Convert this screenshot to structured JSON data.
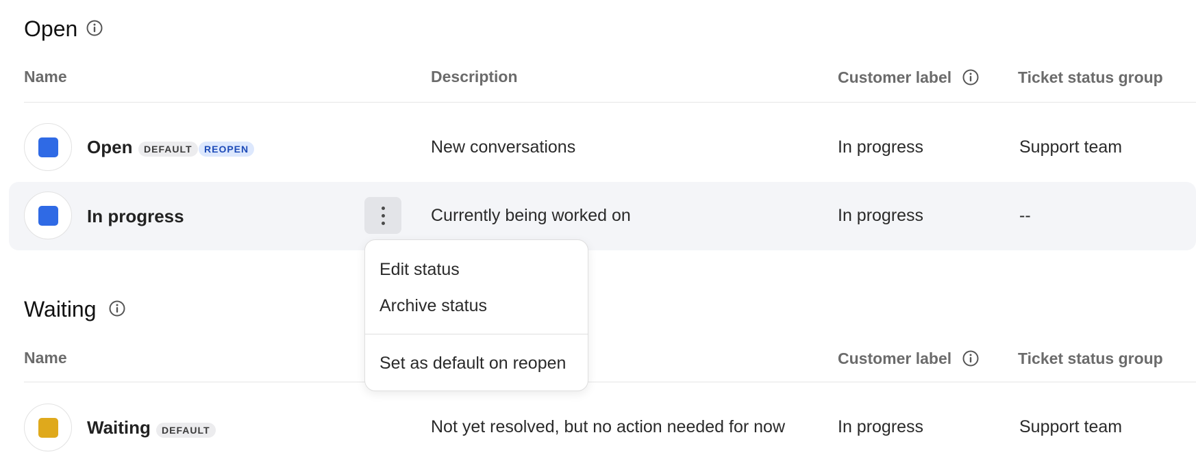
{
  "sections": {
    "open": {
      "title": "Open",
      "columns": {
        "name": "Name",
        "description": "Description",
        "customer_label": "Customer label",
        "ticket_status_group": "Ticket status group"
      },
      "rows": [
        {
          "name": "Open",
          "badges": [
            "DEFAULT",
            "REOPEN"
          ],
          "swatch_color": "#2f6ae5",
          "description": "New conversations",
          "customer_label": "In progress",
          "ticket_status_group": "Support team"
        },
        {
          "name": "In progress",
          "badges": [],
          "swatch_color": "#2f6ae5",
          "description": "Currently being worked on",
          "customer_label": "In progress",
          "ticket_status_group": "--"
        }
      ]
    },
    "waiting": {
      "title": "Waiting",
      "columns": {
        "name": "Name",
        "customer_label": "Customer label",
        "ticket_status_group": "Ticket status group"
      },
      "rows": [
        {
          "name": "Waiting",
          "badges": [
            "DEFAULT"
          ],
          "swatch_color": "#dfa91c",
          "description": "Not yet resolved, but no action needed for now",
          "customer_label": "In progress",
          "ticket_status_group": "Support team"
        }
      ]
    }
  },
  "context_menu": {
    "items": [
      "Edit status",
      "Archive status"
    ],
    "secondary_items": [
      "Set as default on reopen"
    ]
  },
  "icons": {
    "info": "info-circle-icon",
    "more": "vertical-ellipsis-icon"
  },
  "colors": {
    "blue_status": "#2f6ae5",
    "yellow_status": "#dfa91c",
    "reopen_badge_text": "#1e4bb8",
    "hover_row_bg": "#f4f5f8"
  }
}
